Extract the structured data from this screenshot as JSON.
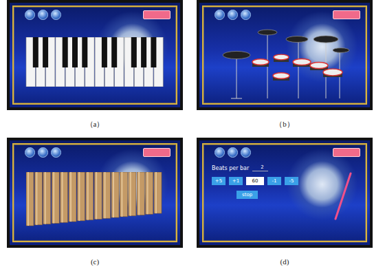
{
  "panels": [
    {
      "caption": "（a）",
      "kind": "piano"
    },
    {
      "caption": "（b）",
      "kind": "drums"
    },
    {
      "caption": "(c)",
      "kind": "panflute"
    },
    {
      "caption": "(d)",
      "kind": "metronome",
      "metronome": {
        "label": "Beats per bar",
        "value": "2",
        "buttons": [
          {
            "label": "+5",
            "kind": "button"
          },
          {
            "label": "+1",
            "kind": "button"
          },
          {
            "label": "60",
            "kind": "display"
          },
          {
            "label": "-1",
            "kind": "button"
          },
          {
            "label": "-5",
            "kind": "button"
          }
        ],
        "stop": "stop"
      }
    }
  ]
}
